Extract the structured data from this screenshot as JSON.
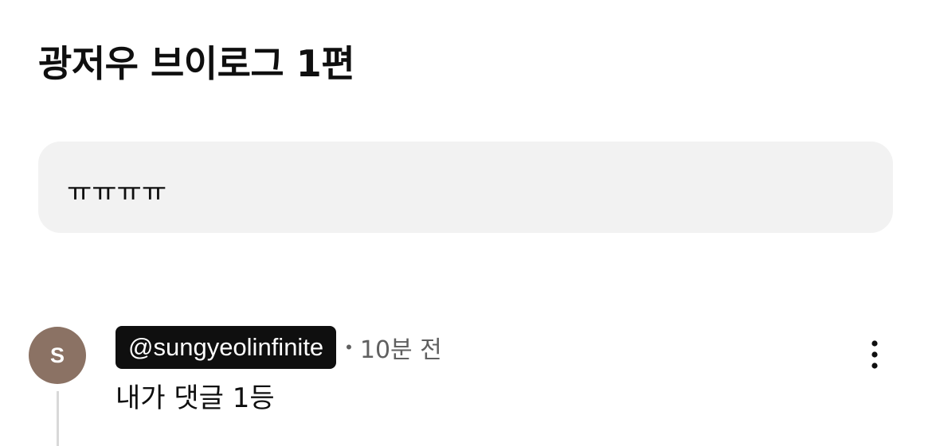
{
  "post": {
    "title": "광저우 브이로그 1편"
  },
  "comment_input": {
    "text": "ㅠㅠㅠㅠ"
  },
  "comment": {
    "avatar_letter": "S",
    "username": "@sungyeolinfinite",
    "separator": "•",
    "timestamp": "10분 전",
    "text": "내가 댓글 1등",
    "more_icon": "more-vert-icon"
  },
  "colors": {
    "avatar_bg": "#8b7264",
    "username_chip_bg": "#0f0f0f",
    "comment_box_bg": "#f2f2f2",
    "secondary_text": "#606060"
  }
}
